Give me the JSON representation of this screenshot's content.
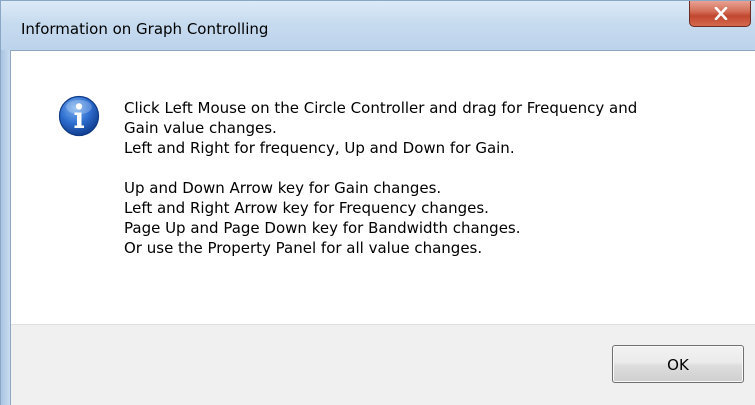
{
  "window": {
    "title": "Information on Graph Controlling",
    "close_icon": "close-icon"
  },
  "dialog": {
    "icon": "info-icon",
    "lines": [
      "Click Left Mouse on the Circle Controller and drag for Frequency and",
      "Gain value changes.",
      "Left and Right for frequency, Up and Down for Gain.",
      "Up and Down Arrow key for Gain changes.",
      "Left and Right Arrow key for Frequency changes.",
      "Page Up and Page Down key for Bandwidth changes.",
      "Or use the Property Panel for all value changes."
    ],
    "ok_label": "OK"
  },
  "colors": {
    "close_button": "#c2472f",
    "info_icon": "#1e5bb8",
    "footer": "#f0f0f0"
  }
}
